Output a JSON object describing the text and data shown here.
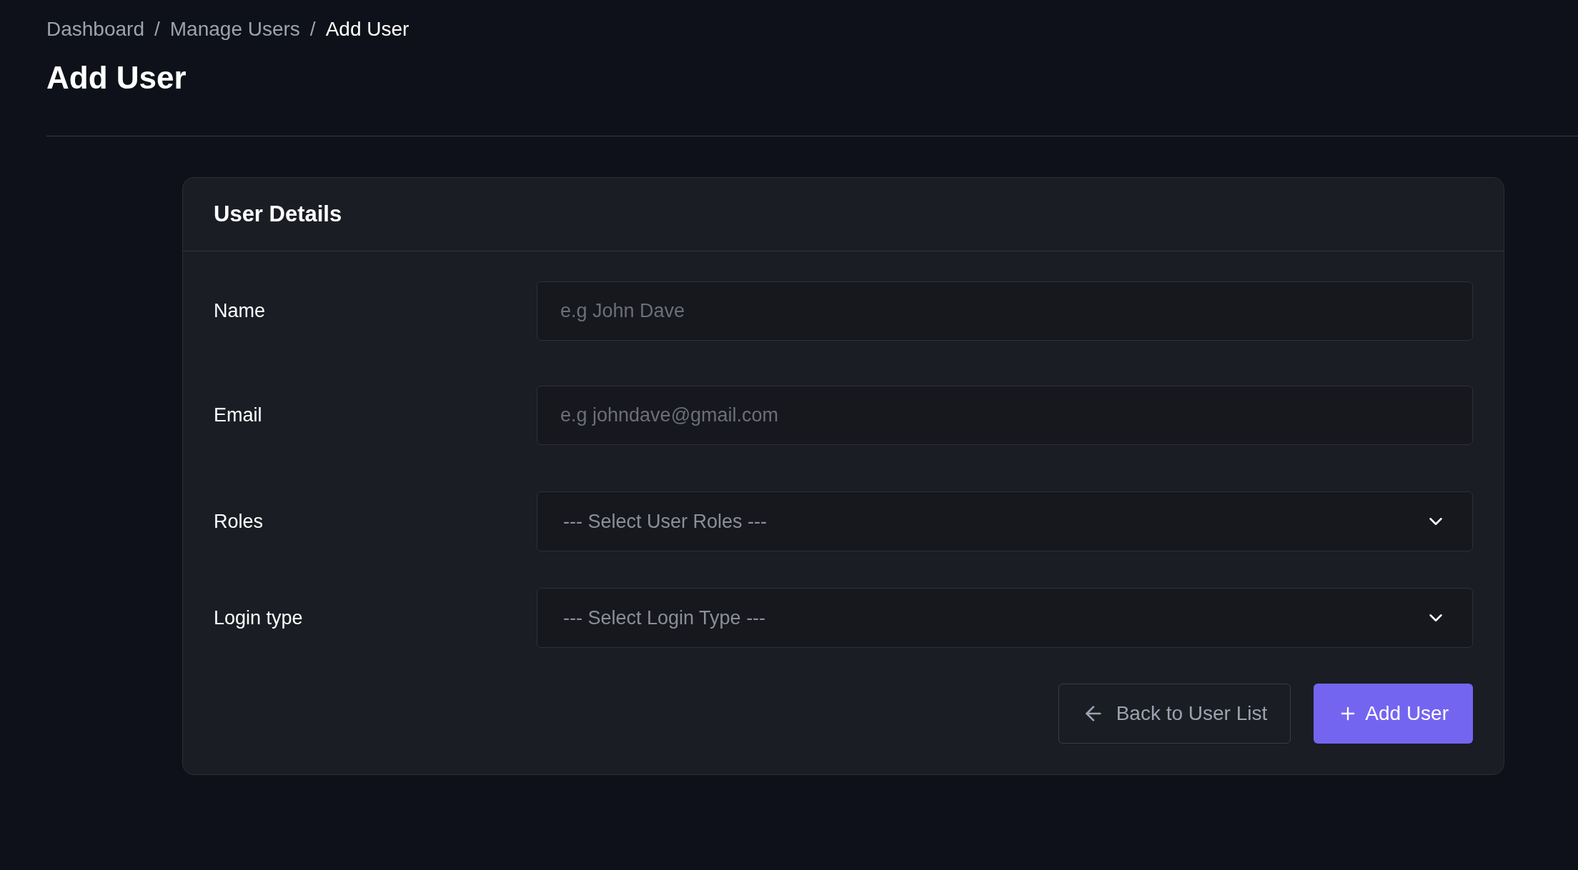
{
  "breadcrumb": [
    {
      "label": "Dashboard",
      "current": false
    },
    {
      "label": "Manage Users",
      "current": false
    },
    {
      "label": "Add User",
      "current": true
    }
  ],
  "breadcrumb_separator": "/",
  "page_title": "Add User",
  "card": {
    "title": "User Details",
    "fields": [
      {
        "kind": "text",
        "label": "Name",
        "placeholder": "e.g John Dave"
      },
      {
        "kind": "text",
        "label": "Email",
        "placeholder": "e.g johndave@gmail.com"
      },
      {
        "kind": "select",
        "label": "Roles",
        "placeholder": "--- Select User Roles ---"
      },
      {
        "kind": "select",
        "label": "Login type",
        "placeholder": "--- Select Login Type ---"
      }
    ],
    "buttons": [
      {
        "kind": "secondary",
        "label": "Back to User List"
      },
      {
        "kind": "primary",
        "label": "Add User"
      }
    ]
  }
}
